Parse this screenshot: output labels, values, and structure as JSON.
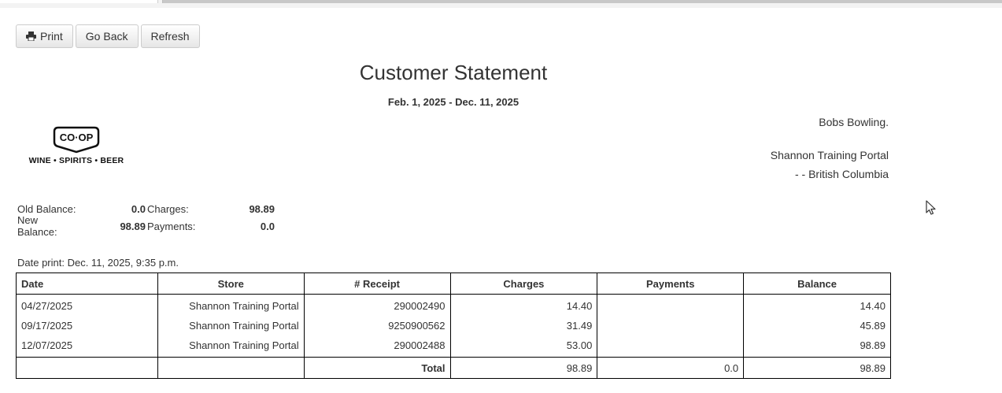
{
  "toolbar": {
    "print_label": "Print",
    "back_label": "Go Back",
    "refresh_label": "Refresh"
  },
  "statement": {
    "title": "Customer Statement",
    "period": "Feb. 1, 2025 - Dec. 11, 2025"
  },
  "logo": {
    "name": "CO·OP",
    "sub": "WINE • SPIRITS • BEER"
  },
  "customer": {
    "name": "Bobs Bowling.",
    "portal": "Shannon Training Portal",
    "region": "- - British Columbia"
  },
  "summary": {
    "old_balance_label": "Old Balance:",
    "old_balance": "0.0",
    "charges_label": "Charges:",
    "charges": "98.89",
    "new_balance_label": "New Balance:",
    "new_balance": "98.89",
    "payments_label": "Payments:",
    "payments": "0.0"
  },
  "date_print": "Date print: Dec. 11, 2025, 9:35 p.m.",
  "table": {
    "headers": [
      "Date",
      "Store",
      "# Receipt",
      "Charges",
      "Payments",
      "Balance"
    ],
    "rows": [
      [
        "04/27/2025",
        "Shannon Training Portal",
        "290002490",
        "14.40",
        "",
        "14.40"
      ],
      [
        "09/17/2025",
        "Shannon Training Portal",
        "9250900562",
        "31.49",
        "",
        "45.89"
      ],
      [
        "12/07/2025",
        "Shannon Training Portal",
        "290002488",
        "53.00",
        "",
        "98.89"
      ]
    ],
    "total_label": "Total",
    "total_charges": "98.89",
    "total_payments": "0.0",
    "total_balance": "98.89"
  },
  "colors": {
    "text": "#333333",
    "border": "#000000",
    "button_border": "#cccccc"
  },
  "icons": {
    "print": "printer-icon",
    "cursor": "mouse-pointer-icon"
  }
}
